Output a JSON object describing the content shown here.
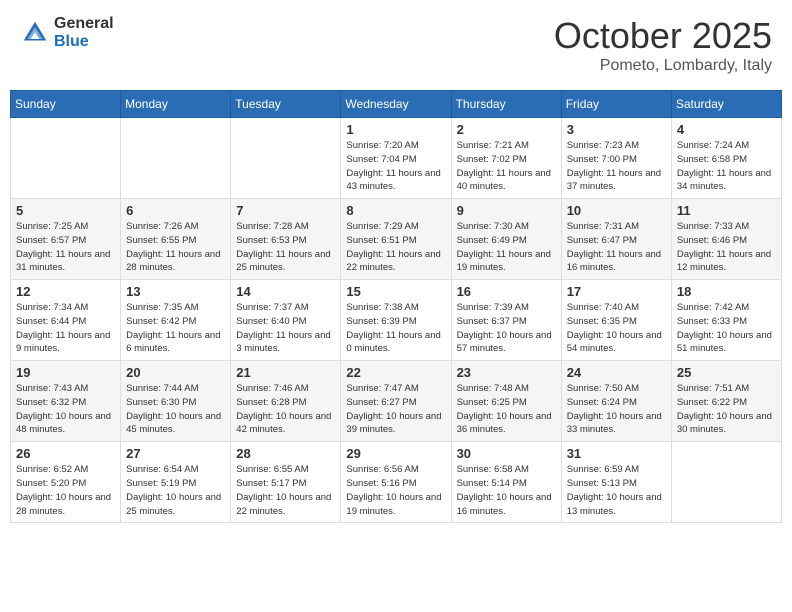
{
  "logo": {
    "general": "General",
    "blue": "Blue"
  },
  "header": {
    "month": "October 2025",
    "location": "Pometo, Lombardy, Italy"
  },
  "weekdays": [
    "Sunday",
    "Monday",
    "Tuesday",
    "Wednesday",
    "Thursday",
    "Friday",
    "Saturday"
  ],
  "weeks": [
    [
      {
        "day": "",
        "info": ""
      },
      {
        "day": "",
        "info": ""
      },
      {
        "day": "",
        "info": ""
      },
      {
        "day": "1",
        "info": "Sunrise: 7:20 AM\nSunset: 7:04 PM\nDaylight: 11 hours and 43 minutes."
      },
      {
        "day": "2",
        "info": "Sunrise: 7:21 AM\nSunset: 7:02 PM\nDaylight: 11 hours and 40 minutes."
      },
      {
        "day": "3",
        "info": "Sunrise: 7:23 AM\nSunset: 7:00 PM\nDaylight: 11 hours and 37 minutes."
      },
      {
        "day": "4",
        "info": "Sunrise: 7:24 AM\nSunset: 6:58 PM\nDaylight: 11 hours and 34 minutes."
      }
    ],
    [
      {
        "day": "5",
        "info": "Sunrise: 7:25 AM\nSunset: 6:57 PM\nDaylight: 11 hours and 31 minutes."
      },
      {
        "day": "6",
        "info": "Sunrise: 7:26 AM\nSunset: 6:55 PM\nDaylight: 11 hours and 28 minutes."
      },
      {
        "day": "7",
        "info": "Sunrise: 7:28 AM\nSunset: 6:53 PM\nDaylight: 11 hours and 25 minutes."
      },
      {
        "day": "8",
        "info": "Sunrise: 7:29 AM\nSunset: 6:51 PM\nDaylight: 11 hours and 22 minutes."
      },
      {
        "day": "9",
        "info": "Sunrise: 7:30 AM\nSunset: 6:49 PM\nDaylight: 11 hours and 19 minutes."
      },
      {
        "day": "10",
        "info": "Sunrise: 7:31 AM\nSunset: 6:47 PM\nDaylight: 11 hours and 16 minutes."
      },
      {
        "day": "11",
        "info": "Sunrise: 7:33 AM\nSunset: 6:46 PM\nDaylight: 11 hours and 12 minutes."
      }
    ],
    [
      {
        "day": "12",
        "info": "Sunrise: 7:34 AM\nSunset: 6:44 PM\nDaylight: 11 hours and 9 minutes."
      },
      {
        "day": "13",
        "info": "Sunrise: 7:35 AM\nSunset: 6:42 PM\nDaylight: 11 hours and 6 minutes."
      },
      {
        "day": "14",
        "info": "Sunrise: 7:37 AM\nSunset: 6:40 PM\nDaylight: 11 hours and 3 minutes."
      },
      {
        "day": "15",
        "info": "Sunrise: 7:38 AM\nSunset: 6:39 PM\nDaylight: 11 hours and 0 minutes."
      },
      {
        "day": "16",
        "info": "Sunrise: 7:39 AM\nSunset: 6:37 PM\nDaylight: 10 hours and 57 minutes."
      },
      {
        "day": "17",
        "info": "Sunrise: 7:40 AM\nSunset: 6:35 PM\nDaylight: 10 hours and 54 minutes."
      },
      {
        "day": "18",
        "info": "Sunrise: 7:42 AM\nSunset: 6:33 PM\nDaylight: 10 hours and 51 minutes."
      }
    ],
    [
      {
        "day": "19",
        "info": "Sunrise: 7:43 AM\nSunset: 6:32 PM\nDaylight: 10 hours and 48 minutes."
      },
      {
        "day": "20",
        "info": "Sunrise: 7:44 AM\nSunset: 6:30 PM\nDaylight: 10 hours and 45 minutes."
      },
      {
        "day": "21",
        "info": "Sunrise: 7:46 AM\nSunset: 6:28 PM\nDaylight: 10 hours and 42 minutes."
      },
      {
        "day": "22",
        "info": "Sunrise: 7:47 AM\nSunset: 6:27 PM\nDaylight: 10 hours and 39 minutes."
      },
      {
        "day": "23",
        "info": "Sunrise: 7:48 AM\nSunset: 6:25 PM\nDaylight: 10 hours and 36 minutes."
      },
      {
        "day": "24",
        "info": "Sunrise: 7:50 AM\nSunset: 6:24 PM\nDaylight: 10 hours and 33 minutes."
      },
      {
        "day": "25",
        "info": "Sunrise: 7:51 AM\nSunset: 6:22 PM\nDaylight: 10 hours and 30 minutes."
      }
    ],
    [
      {
        "day": "26",
        "info": "Sunrise: 6:52 AM\nSunset: 5:20 PM\nDaylight: 10 hours and 28 minutes."
      },
      {
        "day": "27",
        "info": "Sunrise: 6:54 AM\nSunset: 5:19 PM\nDaylight: 10 hours and 25 minutes."
      },
      {
        "day": "28",
        "info": "Sunrise: 6:55 AM\nSunset: 5:17 PM\nDaylight: 10 hours and 22 minutes."
      },
      {
        "day": "29",
        "info": "Sunrise: 6:56 AM\nSunset: 5:16 PM\nDaylight: 10 hours and 19 minutes."
      },
      {
        "day": "30",
        "info": "Sunrise: 6:58 AM\nSunset: 5:14 PM\nDaylight: 10 hours and 16 minutes."
      },
      {
        "day": "31",
        "info": "Sunrise: 6:59 AM\nSunset: 5:13 PM\nDaylight: 10 hours and 13 minutes."
      },
      {
        "day": "",
        "info": ""
      }
    ]
  ]
}
